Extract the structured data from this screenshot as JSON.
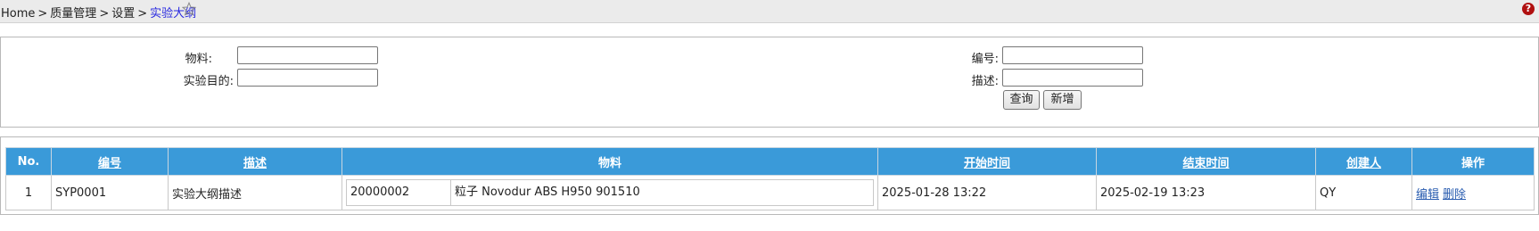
{
  "breadcrumb": {
    "items": [
      "Home",
      "质量管理",
      "设置",
      "实验大纲"
    ],
    "separator": ">"
  },
  "icons": {
    "favorite": "star-outline-icon",
    "help": "help-icon",
    "help_glyph": "?"
  },
  "search": {
    "material_label": "物料:",
    "material_value": "",
    "purpose_label": "实验目的:",
    "purpose_value": "",
    "code_label": "编号:",
    "code_value": "",
    "desc_label": "描述:",
    "desc_value": "",
    "query_button": "查询",
    "add_button": "新增"
  },
  "table": {
    "columns": [
      "No.",
      "编号",
      "描述",
      "物料",
      "开始时间",
      "结束时间",
      "创建人",
      "操作"
    ],
    "rows": [
      {
        "no": "1",
        "code": "SYP0001",
        "description": "实验大纲描述",
        "material_code": "20000002",
        "material_name": "粒子 Novodur ABS H950 901510",
        "start_time": "2025-01-28 13:22",
        "end_time": "2025-02-19 13:23",
        "creator": "QY",
        "edit_label": "编辑",
        "delete_label": "删除"
      }
    ]
  },
  "colors": {
    "header_bg": "#3a9ad9",
    "breadcrumb_current": "#2a2ae0",
    "link": "#2a5db0"
  }
}
